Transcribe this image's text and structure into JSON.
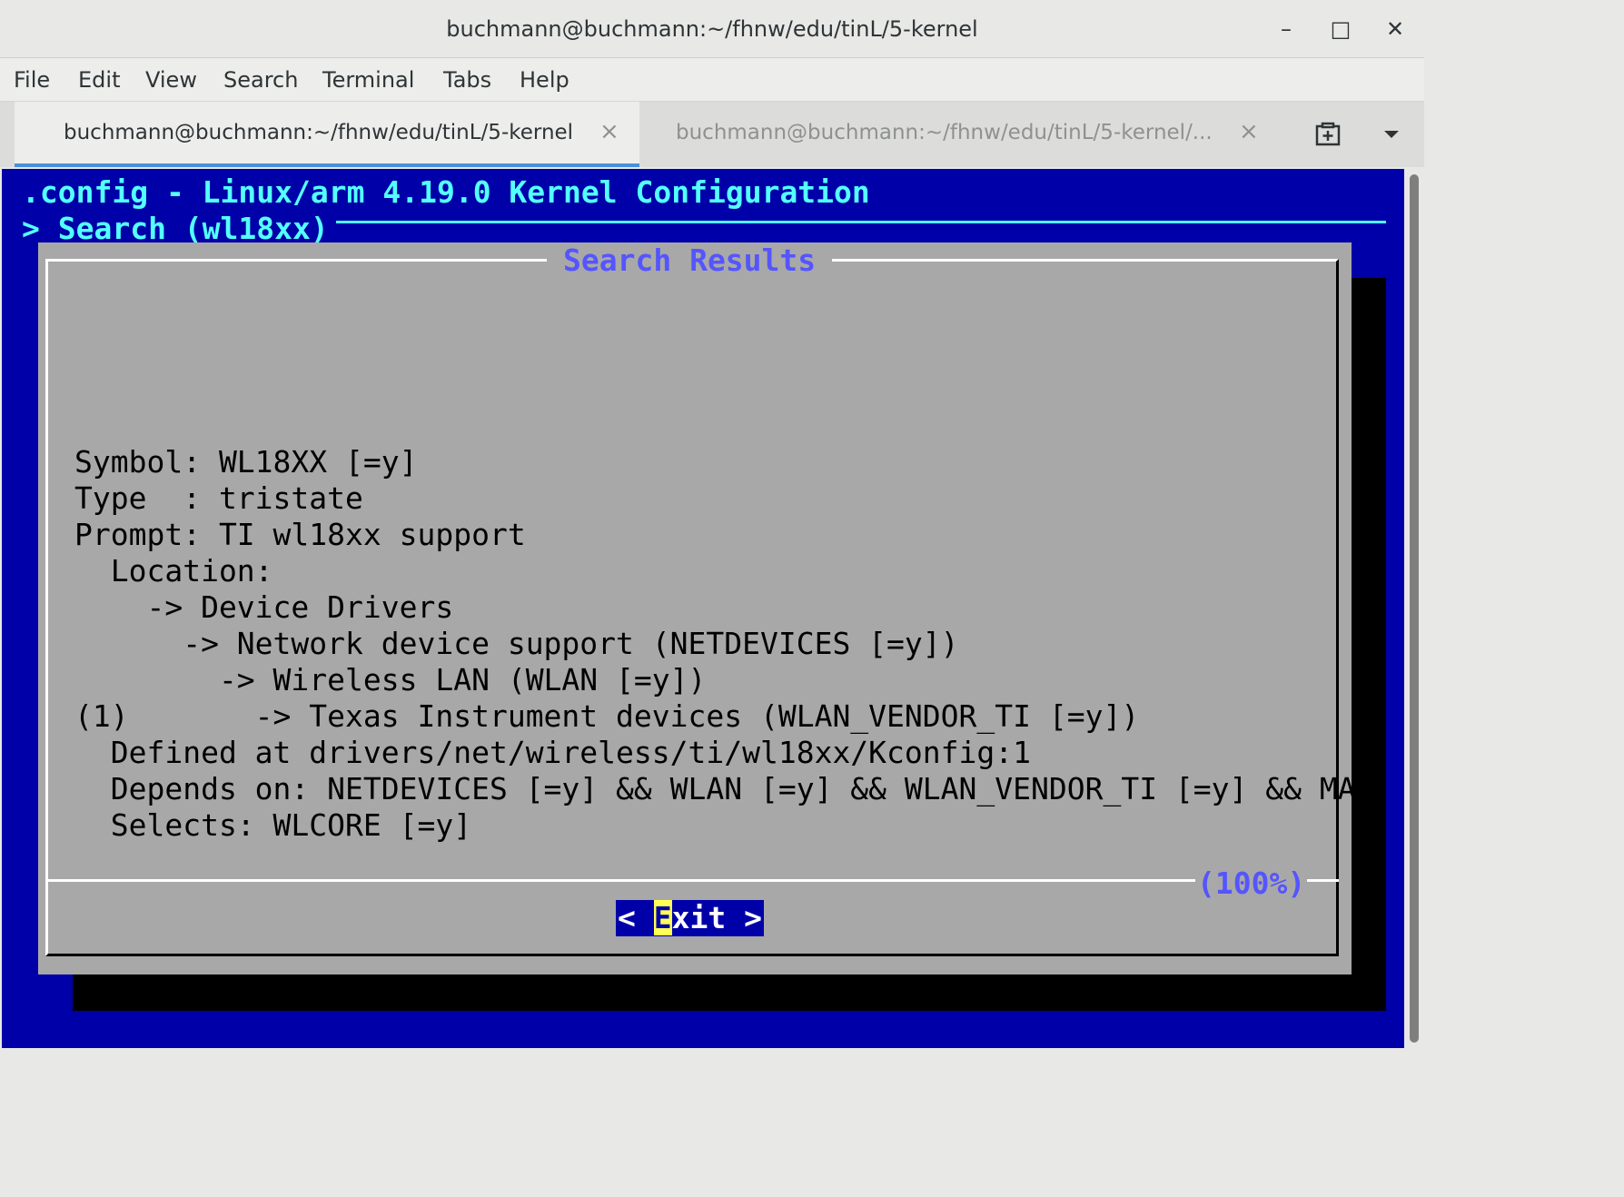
{
  "window": {
    "title": "buchmann@buchmann:~/fhnw/edu/tinL/5-kernel",
    "minimize_glyph": "–",
    "maximize_glyph": "□",
    "close_glyph": "✕"
  },
  "menu": [
    "File",
    "Edit",
    "View",
    "Search",
    "Terminal",
    "Tabs",
    "Help"
  ],
  "tabs": [
    {
      "label": "buchmann@buchmann:~/fhnw/edu/tinL/5-kernel",
      "active": true
    },
    {
      "label": "buchmann@buchmann:~/fhnw/edu/tinL/5-kernel/...",
      "active": false
    }
  ],
  "tab_close_glyph": "×",
  "icons": {
    "new_tab": "new-tab-icon",
    "tab_menu": "chevron-down-icon"
  },
  "terminal": {
    "header_line1": ".config - Linux/arm 4.19.0 Kernel Configuration",
    "header_line2": "> Search (wl18xx)",
    "dialog_title": "Search Results",
    "lines": [
      "Symbol: WL18XX [=y]",
      "Type  : tristate",
      "Prompt: TI wl18xx support",
      "  Location:",
      "    -> Device Drivers",
      "      -> Network device support (NETDEVICES [=y])",
      "        -> Wireless LAN (WLAN [=y])",
      "(1)       -> Texas Instrument devices (WLAN_VENDOR_TI [=y])",
      "  Defined at drivers/net/wireless/ti/wl18xx/Kconfig:1",
      "  Depends on: NETDEVICES [=y] && WLAN [=y] && WLAN_VENDOR_TI [=y] && MA",
      "  Selects: WLCORE [=y]"
    ],
    "scroll_percent": "(100%)",
    "exit_button": {
      "left": "< ",
      "hotkey": "E",
      "rest": "xit >"
    }
  },
  "colors": {
    "terminal_bg": "#0000a8",
    "header_text": "#54ffff",
    "dialog_bg": "#a8a8a8",
    "dialog_title": "#5555ff",
    "hotkey_bg": "#ffff54",
    "active_tab_underline": "#4a90d9"
  }
}
